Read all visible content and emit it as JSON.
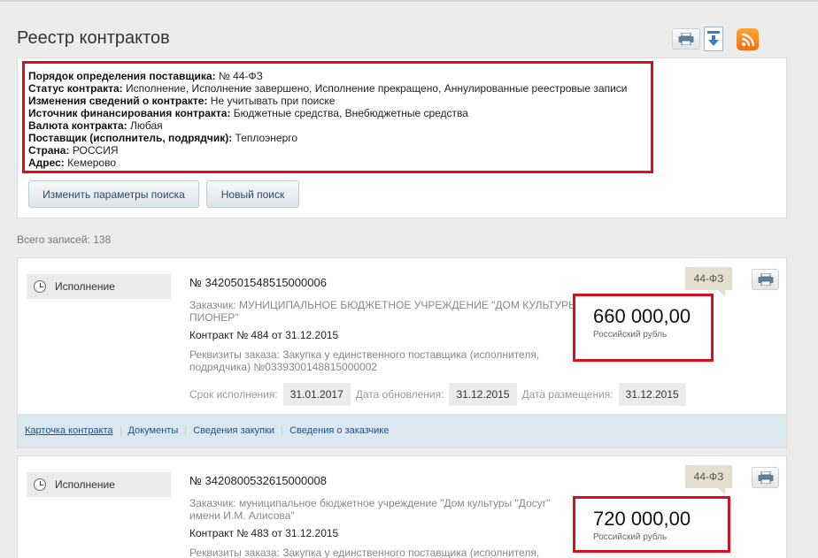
{
  "page": {
    "title": "Реестр контрактов"
  },
  "toolbar": {
    "icons": [
      "print-icon",
      "download-icon",
      "rss-icon"
    ]
  },
  "search_params": [
    {
      "label": "Порядок определения поставщика:",
      "value": "№ 44-ФЗ"
    },
    {
      "label": "Статус контракта:",
      "value": "Исполнение, Исполнение завершено, Исполнение прекращено, Аннулированные реестровые записи"
    },
    {
      "label": "Изменения сведений о контракте:",
      "value": "Не учитывать при поиске"
    },
    {
      "label": "Источник финансирования контракта:",
      "value": "Бюджетные средства, Внебюджетные средства"
    },
    {
      "label": "Валюта контракта:",
      "value": "Любая"
    },
    {
      "label": "Поставщик (исполнитель, подрядчик):",
      "value": "Теплоэнерго"
    },
    {
      "label": "Страна:",
      "value": "РОССИЯ"
    },
    {
      "label": "Адрес:",
      "value": "Кемерово"
    }
  ],
  "buttons": {
    "change_params": "Изменить параметры поиска",
    "new_search": "Новый поиск"
  },
  "total": "Всего записей: 138",
  "contracts": [
    {
      "status": "Исполнение",
      "law": "44-ФЗ",
      "number": "№ 3420501548515000006",
      "customer_line1": "Заказчик: МУНИЦИПАЛЬНОЕ БЮДЖЕТНОЕ УЧРЕЖДЕНИЕ \"ДОМ КУЛЬТУРЫ",
      "customer_line2": "ПИОНЕР\"",
      "contract": "Контракт № 484 от 31.12.2015",
      "order_line1": "Реквизиты заказа: Закупка у единственного поставщика (исполнителя,",
      "order_line2": "подрядчика) №0339300148815000002",
      "term_label": "Срок исполнения:",
      "term_value": "31.01.2017",
      "updated_label": "Дата обновления:",
      "updated_value": "31.12.2015",
      "posted_label": "Дата размещения:",
      "posted_value": "31.12.2015",
      "price": "660 000,00",
      "currency": "Российский рубль",
      "links": [
        "Карточка контракта",
        "Документы",
        "Сведения закупки",
        "Сведения о заказчике"
      ]
    },
    {
      "status": "Исполнение",
      "law": "44-ФЗ",
      "number": "№ 3420800532615000008",
      "customer_line1": "Заказчик: муниципальное бюджетное учреждение \"Дом культуры \"Досуг\"",
      "customer_line2": "имени И.М. Алисова\"",
      "contract": "Контракт № 483 от 31.12.2015",
      "order_line1": "Реквизиты заказа: Закупка у единственного поставщика (исполнителя,",
      "price": "720 000,00",
      "currency": "Российский рубль"
    }
  ]
}
